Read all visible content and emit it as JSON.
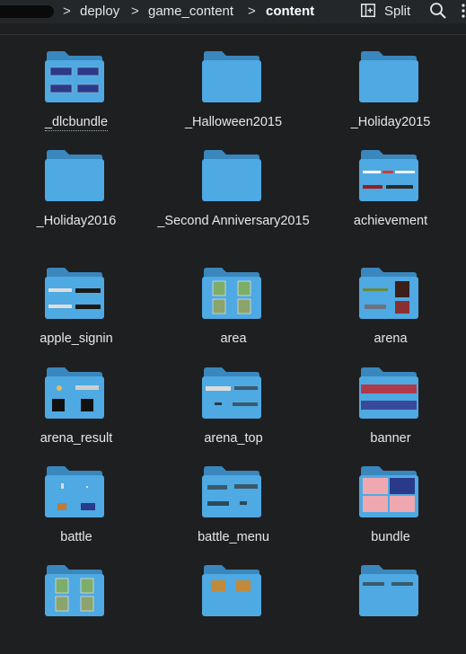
{
  "breadcrumb": {
    "items": [
      "deploy",
      "game_content",
      "content"
    ],
    "separator": ">"
  },
  "toolbar": {
    "split_label": "Split"
  },
  "colors": {
    "folder_front": "#4fa9e2",
    "folder_back": "#3a87bd",
    "background": "#1e1f21"
  },
  "folders": [
    {
      "name": "_dlcbundle",
      "thumb": "buttons-thumbnail"
    },
    {
      "name": "_Halloween2015",
      "thumb": "none"
    },
    {
      "name": "_Holiday2015",
      "thumb": "none"
    },
    {
      "name": "_Holiday2016",
      "thumb": "none"
    },
    {
      "name": "_Second Anniversary2015",
      "thumb": "none"
    },
    {
      "name": "achievement",
      "thumb": "bars-thumbnail"
    },
    {
      "name": "apple_signin",
      "thumb": "signin-thumbnail"
    },
    {
      "name": "area",
      "thumb": "cards-thumbnail"
    },
    {
      "name": "arena",
      "thumb": "arena-thumbnail"
    },
    {
      "name": "arena_result",
      "thumb": "result-thumbnail"
    },
    {
      "name": "arena_top",
      "thumb": "top-thumbnail"
    },
    {
      "name": "banner",
      "thumb": "banner-thumbnail"
    },
    {
      "name": "battle",
      "thumb": "battle-thumbnail"
    },
    {
      "name": "battle_menu",
      "thumb": "menu-thumbnail"
    },
    {
      "name": "bundle",
      "thumb": "bundle-thumbnail"
    },
    {
      "name": "",
      "thumb": "cards-thumbnail"
    },
    {
      "name": "",
      "thumb": "chest-thumbnail"
    },
    {
      "name": "",
      "thumb": "misc-thumbnail"
    }
  ]
}
